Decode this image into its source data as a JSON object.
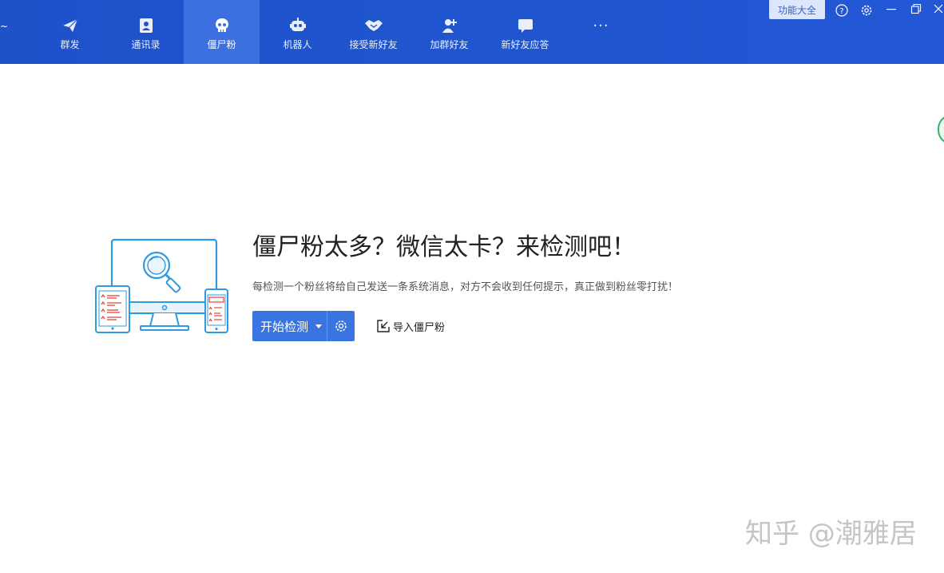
{
  "topbar": {
    "edge_glyph": "~",
    "nav": [
      {
        "label": "群发",
        "icon": "paper-plane-icon"
      },
      {
        "label": "通讯录",
        "icon": "contacts-book-icon"
      },
      {
        "label": "僵尸粉",
        "icon": "skull-icon",
        "active": true
      },
      {
        "label": "机器人",
        "icon": "robot-icon"
      },
      {
        "label": "接受新好友",
        "icon": "handshake-icon"
      },
      {
        "label": "加群好友",
        "icon": "add-user-icon"
      },
      {
        "label": "新好友应答",
        "icon": "chat-bubble-icon"
      },
      {
        "label": "···",
        "icon": "more-icon"
      }
    ],
    "function_button": "功能大全",
    "window_controls": [
      "help-icon",
      "settings-gear-icon",
      "minimize-icon",
      "restore-icon",
      "close-icon"
    ]
  },
  "main": {
    "headline": "僵尸粉太多？微信太卡？来检测吧！",
    "description": "每检测一个粉丝将给自己发送一条系统消息，对方不会收到任何提示，真正做到粉丝零打扰！",
    "start_button": "开始检测",
    "import_link": "导入僵尸粉",
    "illustration": "device-scan-illustration"
  },
  "watermark": "知乎 @潮雅居",
  "colors": {
    "topbar": "#1f52c9",
    "active_tab": "#3c6fe0",
    "primary_button": "#3a74e0",
    "illustration_blue": "#2f9ae0",
    "illustration_red": "#e0463a"
  }
}
